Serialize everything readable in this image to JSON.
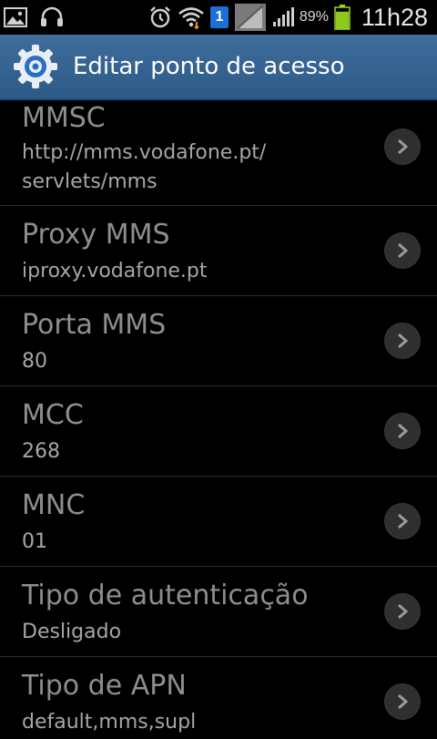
{
  "status_bar": {
    "icons_left": [
      "image-icon",
      "headset-icon"
    ],
    "icons_right": [
      "alarm-icon",
      "wifi-icon",
      "sim-icon",
      "no-signal-icon",
      "signal-icon",
      "battery-icon"
    ],
    "sim_number": "1",
    "battery_percent": "89%",
    "battery_level": 0.89,
    "time": "11h28"
  },
  "action_bar": {
    "title": "Editar ponto de acesso",
    "icon": "settings-gear-icon",
    "accent_color": "#2d5a87"
  },
  "list": {
    "items": [
      {
        "title": "MMSC",
        "value": "http://mms.vodafone.pt/ servlets/mms"
      },
      {
        "title": "Proxy MMS",
        "value": "iproxy.vodafone.pt"
      },
      {
        "title": "Porta MMS",
        "value": "80"
      },
      {
        "title": "MCC",
        "value": "268"
      },
      {
        "title": "MNC",
        "value": "01"
      },
      {
        "title": "Tipo de autenticação",
        "value": "Desligado"
      },
      {
        "title": "Tipo de APN",
        "value": "default,mms,supl"
      }
    ]
  }
}
